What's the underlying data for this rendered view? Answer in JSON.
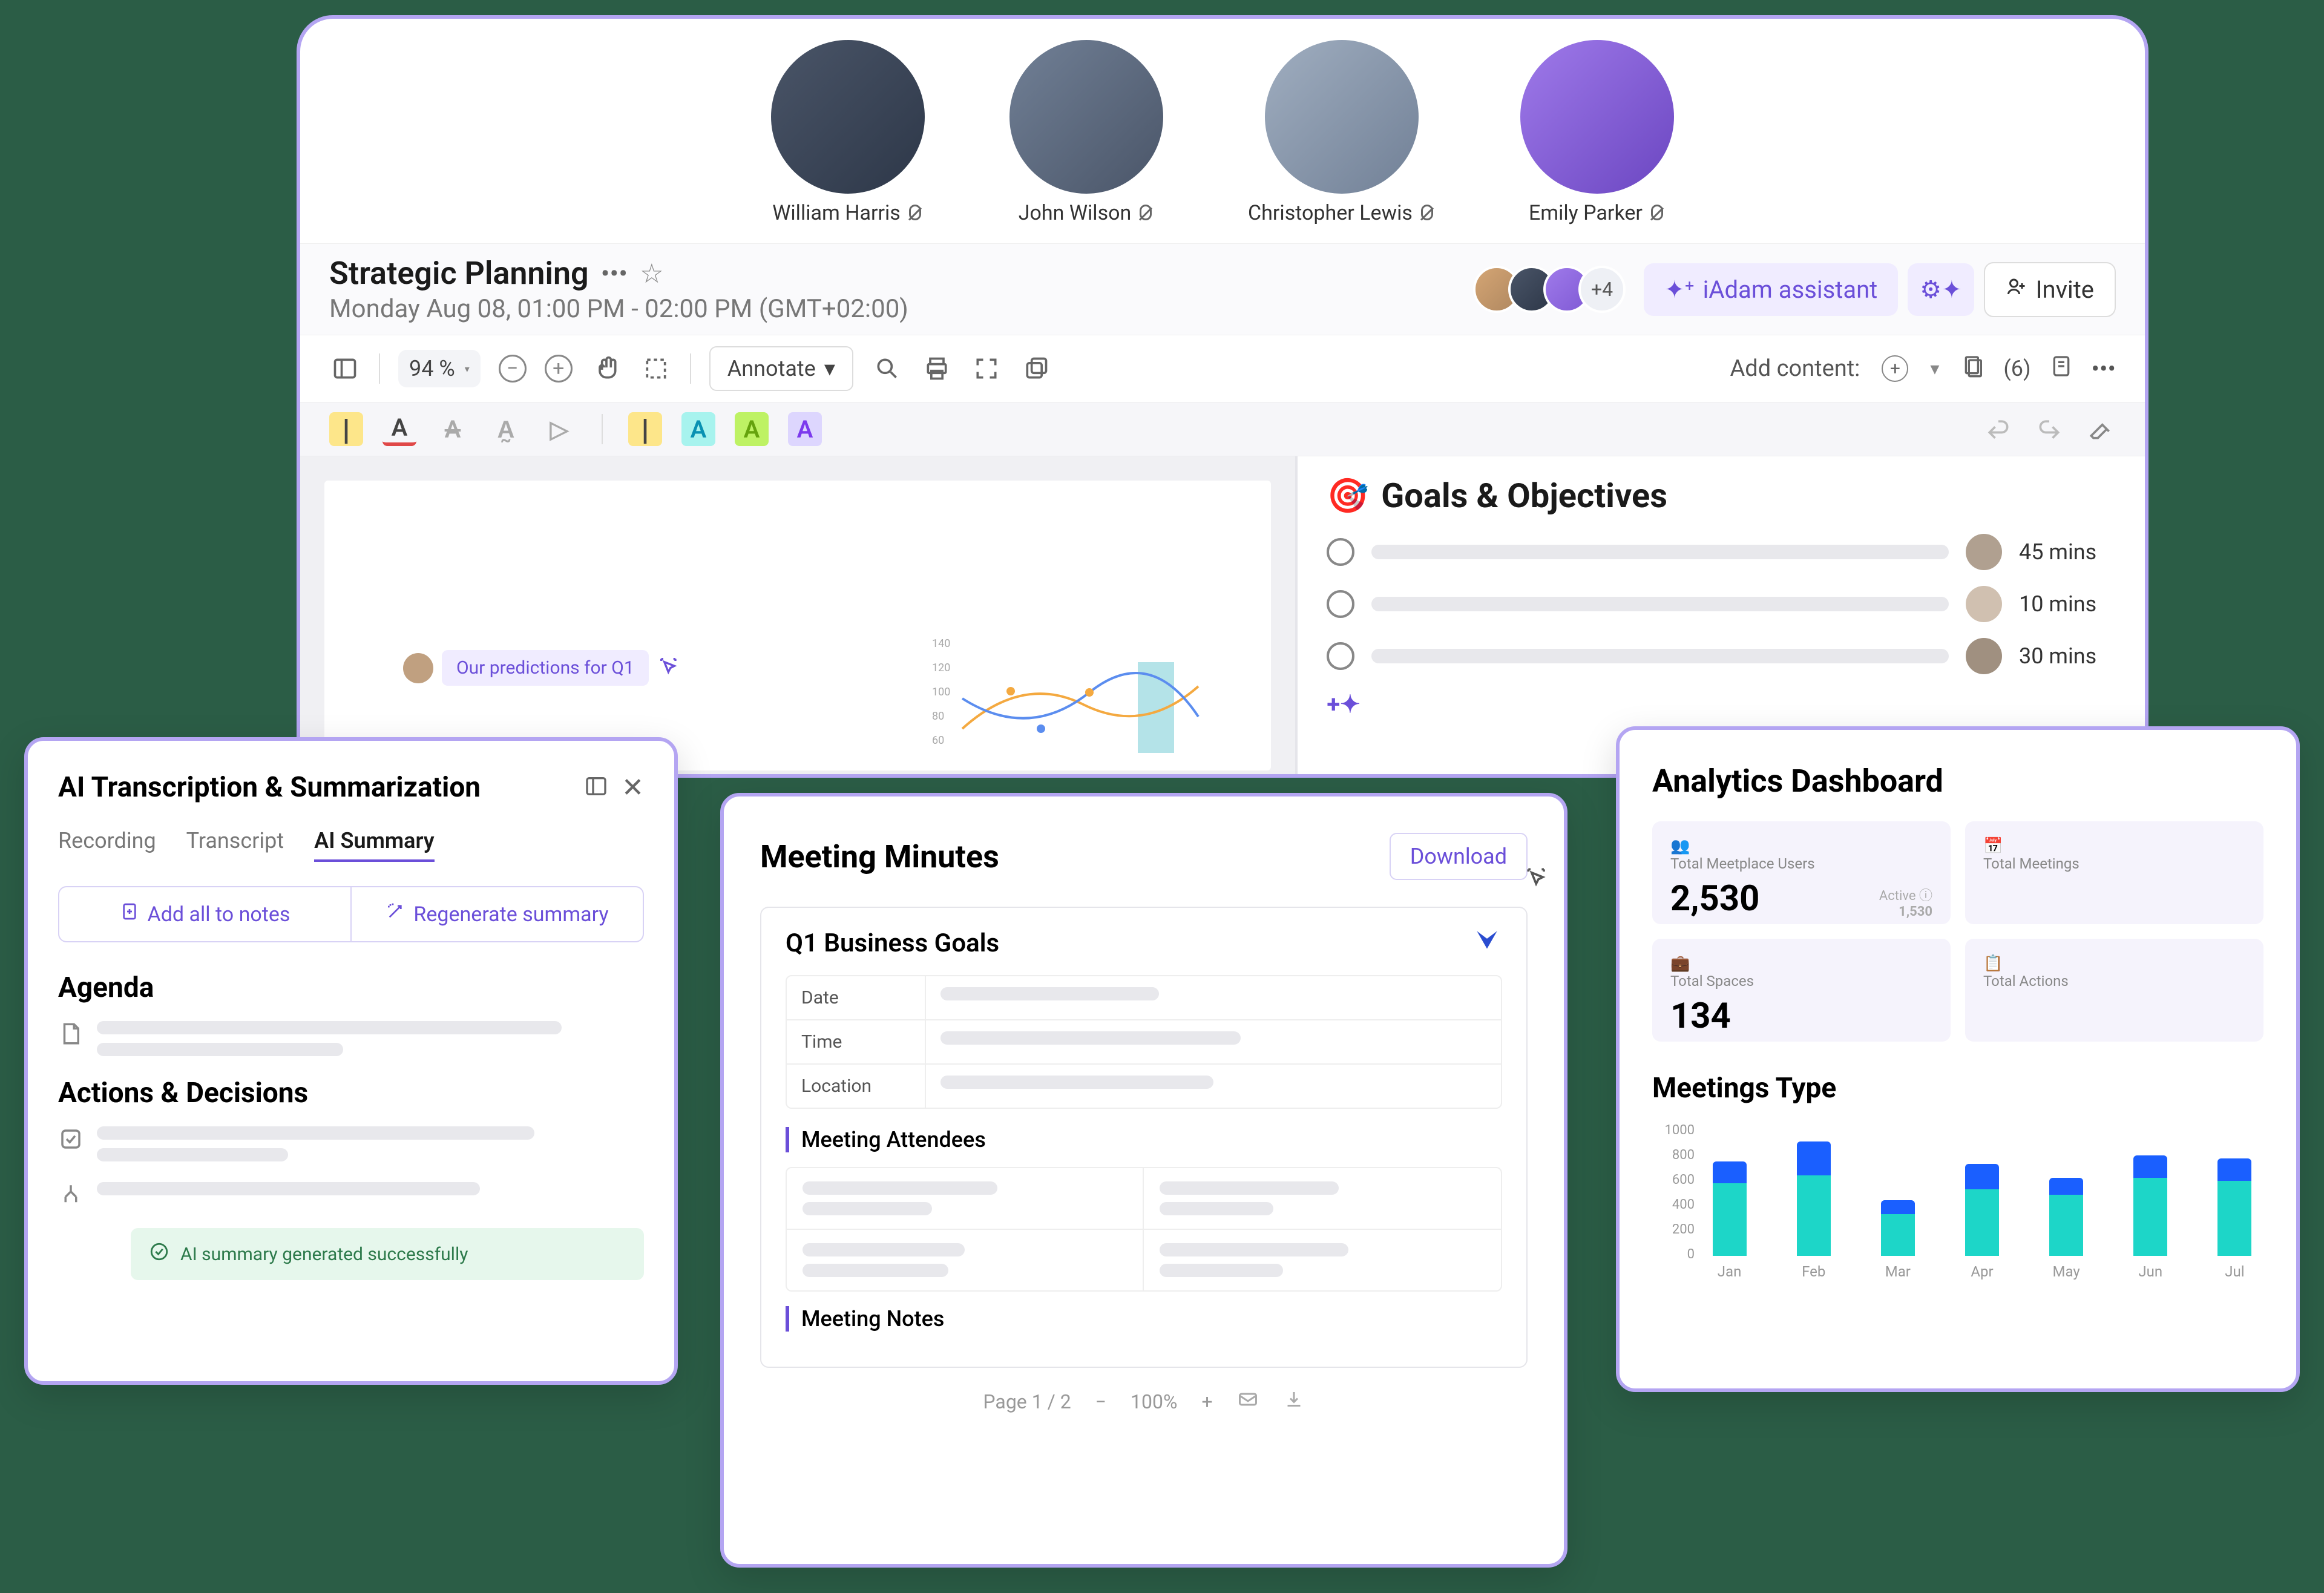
{
  "participants": [
    {
      "name": "William Harris"
    },
    {
      "name": "John Wilson"
    },
    {
      "name": "Christopher Lewis"
    },
    {
      "name": "Emily Parker"
    }
  ],
  "meeting": {
    "title": "Strategic Planning",
    "time": "Monday Aug 08, 01:00 PM - 02:00 PM (GMT+02:00)",
    "extra_avatars": "+4",
    "assistant_btn": "iAdam assistant",
    "invite_btn": "Invite"
  },
  "toolbar": {
    "zoom": "94 %",
    "annotate": "Annotate"
  },
  "side": {
    "add_content": "Add content:",
    "pages": "(6)",
    "goals_title": "Goals & Objectives",
    "goals_icon": "🎯",
    "items": [
      {
        "time": "45 mins"
      },
      {
        "time": "10 mins"
      },
      {
        "time": "30 mins"
      }
    ]
  },
  "comment": {
    "text": "Our predictions for Q1"
  },
  "mini_chart_ticks": [
    "140",
    "120",
    "100",
    "80",
    "60"
  ],
  "ai": {
    "title": "AI Transcription & Summarization",
    "tabs": {
      "recording": "Recording",
      "transcript": "Transcript",
      "summary": "AI Summary"
    },
    "add_all": "Add all to notes",
    "regenerate": "Regenerate summary",
    "agenda": "Agenda",
    "actions": "Actions & Decisions",
    "success": "AI summary generated successfully"
  },
  "minutes": {
    "title": "Meeting Minutes",
    "download": "Download",
    "card_title": "Q1 Business Goals",
    "meta": {
      "date": "Date",
      "time": "Time",
      "location": "Location"
    },
    "attendees": "Meeting Attendees",
    "notes": "Meeting Notes",
    "pager": {
      "page": "Page 1 / 2",
      "zoom": "100%"
    }
  },
  "analytics": {
    "title": "Analytics Dashboard",
    "cards": {
      "users": {
        "label": "Total Meetplace Users",
        "value": "2,530",
        "sub_label": "Active",
        "sub_value": "1,530"
      },
      "meetings": {
        "label": "Total Meetings"
      },
      "spaces": {
        "label": "Total Spaces",
        "value": "134"
      },
      "actions": {
        "label": "Total Actions"
      }
    },
    "chart_title": "Meetings Type"
  },
  "chart_data": {
    "type": "bar",
    "title": "Meetings Type",
    "ylabel": "",
    "ylim": [
      0,
      1000
    ],
    "y_ticks": [
      1000,
      800,
      600,
      400,
      200,
      0
    ],
    "categories": [
      "Jan",
      "Feb",
      "Mar",
      "Apr",
      "May",
      "Jun",
      "Jul"
    ],
    "series": [
      {
        "name": "segment_bottom",
        "color": "#1dd6c8",
        "values": [
          520,
          580,
          300,
          480,
          440,
          560,
          540
        ]
      },
      {
        "name": "segment_top",
        "color": "#1a5fff",
        "values": [
          160,
          240,
          100,
          180,
          120,
          160,
          160
        ]
      }
    ]
  }
}
